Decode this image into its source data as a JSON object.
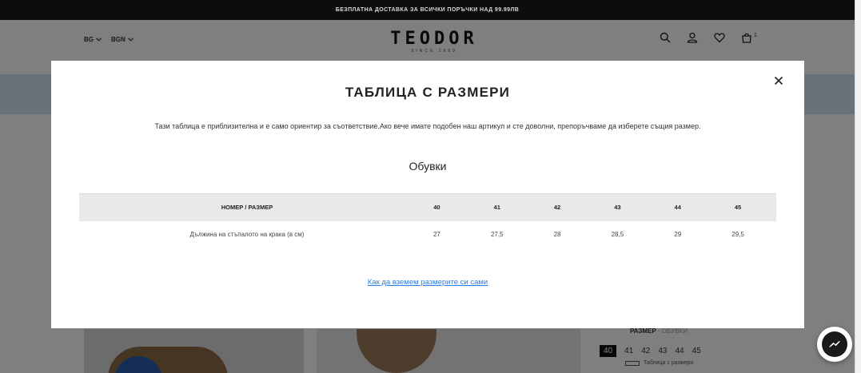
{
  "topbar": {
    "text": "БЕЗПЛАТНА ДОСТАВКА ЗА ВСИЧКИ ПОРЪЧКИ НАД 99.99ЛВ"
  },
  "header": {
    "language": "BG",
    "currency": "BGN",
    "logo_text": "TEODOR",
    "logo_since": "SINCE 1989",
    "cart_count": "1"
  },
  "product": {
    "size_label": "РАЗМЕР",
    "size_category": "- ОБУВКИ",
    "sizes": [
      "40",
      "41",
      "42",
      "43",
      "44",
      "45"
    ],
    "selected_size": "40",
    "size_guide_link": "Таблица с размери"
  },
  "modal": {
    "title": "ТАБЛИЦА С РАЗМЕРИ",
    "description": "Тази таблица е приблизителна и е само ориентир за съответствие.Ако вече имате подобен наш артикул и сте доволни, препоръчваме да изберете същия размер.",
    "subtitle": "Обувки",
    "table": {
      "headers": [
        "НОМЕР / РАЗМЕР",
        "40",
        "41",
        "42",
        "43",
        "44",
        "45"
      ],
      "rows": [
        [
          "Дължина на стъпалото на крака (в см)",
          "27",
          "27,5",
          "28",
          "28,5",
          "29",
          "29,5"
        ]
      ]
    },
    "link_text": "Как да вземем размерите си сами"
  }
}
